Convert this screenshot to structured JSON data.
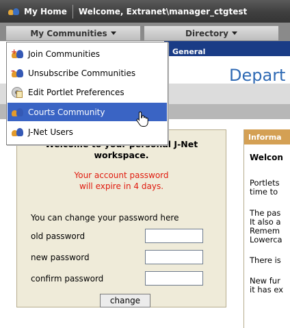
{
  "topbar": {
    "home_label": "My Home",
    "welcome_text": "Welcome, Extranet\\manager_ctgtest"
  },
  "nav": {
    "my_communities": "My Communities",
    "directory": "Directory"
  },
  "banner": {
    "strip_text": "General",
    "dept_text": "Depart"
  },
  "dropdown": {
    "items": [
      {
        "label": "Join Communities",
        "icon": "join-communities-icon"
      },
      {
        "label": "Unsubscribe Communities",
        "icon": "unsubscribe-communities-icon"
      },
      {
        "label": "Edit Portlet Preferences",
        "icon": "edit-preferences-icon"
      },
      {
        "label": "Courts Community",
        "icon": "community-icon",
        "highlighted": true
      },
      {
        "label": "J-Net Users",
        "icon": "community-icon"
      }
    ],
    "highlight_color": "#3a64c4"
  },
  "password_panel": {
    "title_line1": "Welcome to your personal J-Net",
    "title_line2": "workspace.",
    "warning_line1": "Your account password",
    "warning_line2": "will expire in 4 days.",
    "change_text": "You can change your password here",
    "old_password_label": "old password",
    "new_password_label": "new password",
    "confirm_password_label": "confirm password",
    "old_password_value": "",
    "new_password_value": "",
    "confirm_password_value": "",
    "change_button": "change",
    "warning_color": "#e0190d"
  },
  "info_panel": {
    "header": "Informa",
    "welcome": "Welcon",
    "p1_l1": "Portlets",
    "p1_l2": "time to",
    "p2_l1": "The pas",
    "p2_l2": "It also a",
    "p2_l3": "Remem",
    "p2_l4": "Lowerca",
    "p3_l1": "There is",
    "p4_l1": "New fur",
    "p4_l2": "it has ex"
  }
}
